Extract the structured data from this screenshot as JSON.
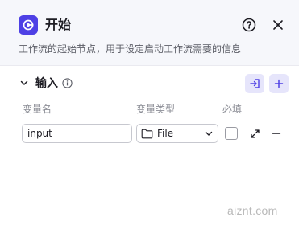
{
  "node": {
    "title": "开始",
    "description": "工作流的起始节点，用于设定启动工作流需要的信息",
    "icon": "start-node-icon"
  },
  "header": {
    "help_icon": "question-circle-icon",
    "close_icon": "close-icon"
  },
  "input_section": {
    "title": "输入",
    "info_icon": "info-circle-icon",
    "import_icon": "import-icon",
    "add_icon": "plus-icon",
    "columns": {
      "name": "变量名",
      "type": "变量类型",
      "required": "必填"
    },
    "rows": [
      {
        "name": "input",
        "type": "File",
        "required": false
      }
    ]
  },
  "watermark": "aiznt.com",
  "colors": {
    "accent": "#4e40e5",
    "accent_soft": "#e6e5fb",
    "header_bg": "#f6f7fb"
  }
}
